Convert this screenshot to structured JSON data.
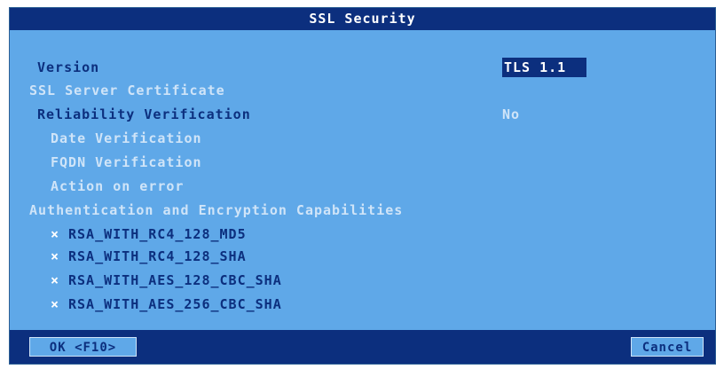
{
  "dialog": {
    "title": "SSL Security",
    "version_label": "Version",
    "version_value": "TLS 1.1",
    "server_cert_label": "SSL Server Certificate",
    "reliability_label": "Reliability Verification",
    "reliability_value": "No",
    "date_label": "Date Verification",
    "fqdn_label": "FQDN Verification",
    "action_label": "Action on error",
    "caps_label": "Authentication and Encryption Capabilities",
    "ciphers": [
      {
        "name": "RSA_WITH_RC4_128_MD5",
        "mark": "×"
      },
      {
        "name": "RSA_WITH_RC4_128_SHA",
        "mark": "×"
      },
      {
        "name": "RSA_WITH_AES_128_CBC_SHA",
        "mark": "×"
      },
      {
        "name": "RSA_WITH_AES_256_CBC_SHA",
        "mark": "×"
      }
    ]
  },
  "buttons": {
    "ok_label": "OK <F10>",
    "cancel_label": "Cancel"
  },
  "colors": {
    "background": "#5fa8e8",
    "title_bar": "#0c2f7e",
    "disabled_text": "#cfe4f8",
    "text": "#0c2f7e"
  }
}
